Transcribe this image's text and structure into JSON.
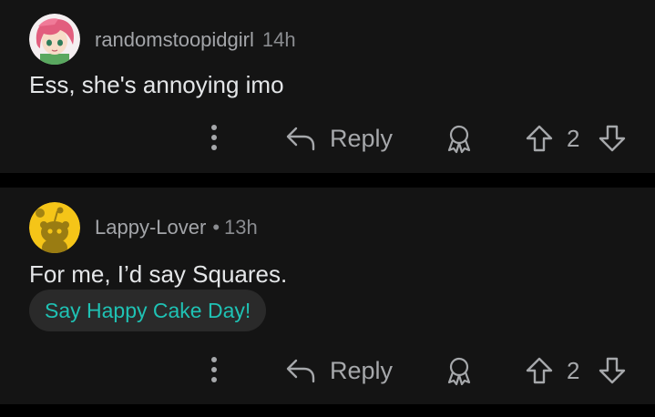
{
  "comments": [
    {
      "username": "randomstoopidgirl",
      "time": "14h",
      "body": "Ess, she's annoying imo",
      "reply_label": "Reply",
      "score": "2",
      "avatar_icon": "anime-girl-avatar"
    },
    {
      "username": "Lappy-Lover",
      "separator": "•",
      "time": "13h",
      "body": "For me, I’d say Squares.",
      "cake_day_label": "Say Happy Cake Day!",
      "reply_label": "Reply",
      "score": "2",
      "avatar_icon": "snoo-avatar"
    }
  ],
  "colors": {
    "background": "#000000",
    "card": "#141414",
    "text": "#e4e6e8",
    "muted": "#8a8c90",
    "accent": "#1fc2b4",
    "chip": "#2a2a2a"
  },
  "icons": [
    "more-options-icon",
    "reply-icon",
    "award-icon",
    "upvote-icon",
    "downvote-icon"
  ]
}
